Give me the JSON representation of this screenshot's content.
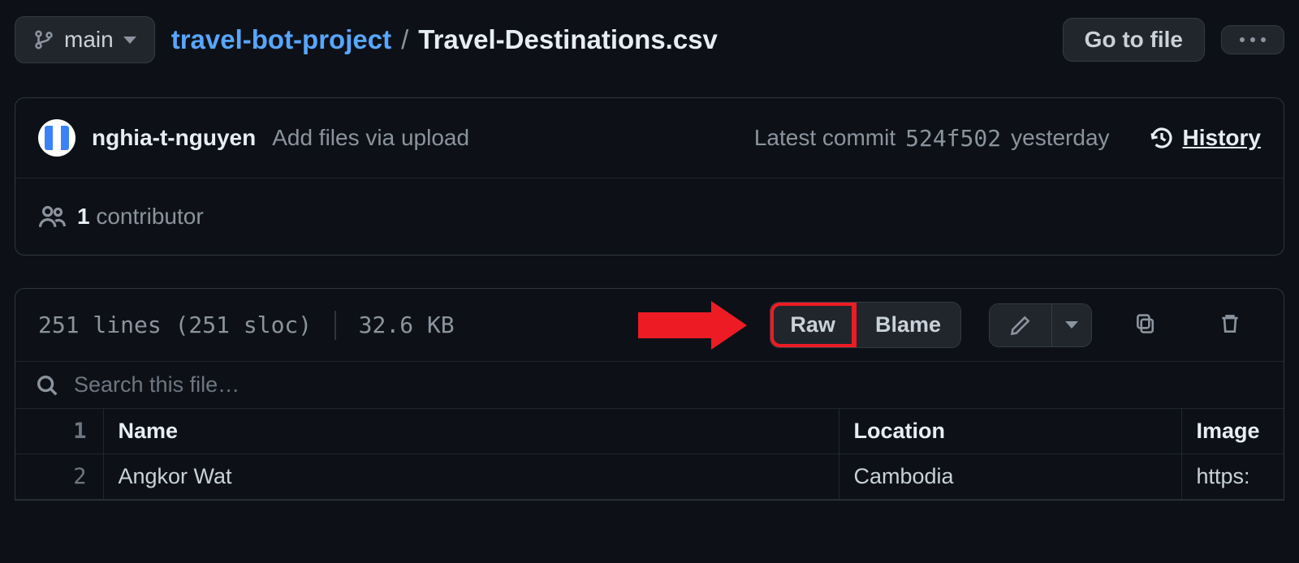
{
  "branch": {
    "name": "main"
  },
  "breadcrumb": {
    "repo": "travel-bot-project",
    "sep": "/",
    "file": "Travel-Destinations.csv"
  },
  "actions": {
    "go_to_file": "Go to file"
  },
  "commit": {
    "author": "nghia-t-nguyen",
    "message": "Add files via upload",
    "latest_label": "Latest commit",
    "hash": "524f502",
    "time": "yesterday",
    "history_label": "History"
  },
  "contributors": {
    "count": "1",
    "label": "contributor"
  },
  "fileinfo": {
    "lines": "251 lines (251 sloc)",
    "size": "32.6 KB"
  },
  "toolbar": {
    "raw": "Raw",
    "blame": "Blame"
  },
  "search": {
    "placeholder": "Search this file…"
  },
  "table": {
    "headers": {
      "c1": "Name",
      "c2": "Location",
      "c3": "Image"
    },
    "rows": [
      {
        "n": "2",
        "c1": "Angkor Wat",
        "c2": "Cambodia",
        "c3": "https:"
      }
    ],
    "header_line": "1"
  }
}
